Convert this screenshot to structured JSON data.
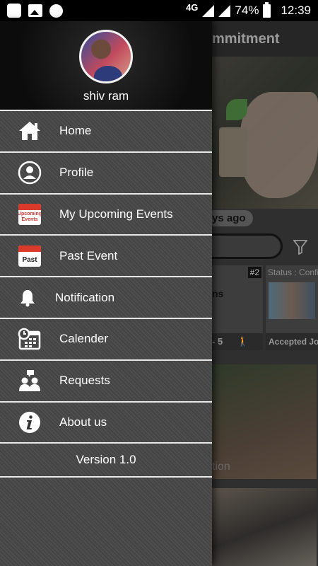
{
  "status_bar": {
    "network": "4G",
    "battery": "74%",
    "time": "12:39"
  },
  "background_app": {
    "toolbar_title": "mmitment",
    "time_ago": "ys ago",
    "card1": {
      "badge": "#2",
      "title": "ns",
      "footer": "- 5"
    },
    "card2": {
      "status": "Status : Confi",
      "footer": "Accepted Jo"
    },
    "image_caption": "tion"
  },
  "drawer": {
    "user_name": "shiv ram",
    "items": [
      {
        "label": "Home",
        "icon": "home-icon"
      },
      {
        "label": "Profile",
        "icon": "profile-icon"
      },
      {
        "label": "My Upcoming Events",
        "icon": "upcoming-calendar-icon",
        "icon_text": "Upcoming Events"
      },
      {
        "label": "Past Event",
        "icon": "past-calendar-icon",
        "icon_text": "Past"
      },
      {
        "label": "Notification",
        "icon": "bell-icon"
      },
      {
        "label": "Calender",
        "icon": "calendar-clock-icon"
      },
      {
        "label": "Requests",
        "icon": "requests-icon"
      },
      {
        "label": "About us",
        "icon": "info-icon"
      }
    ],
    "version": "Version 1.0"
  }
}
